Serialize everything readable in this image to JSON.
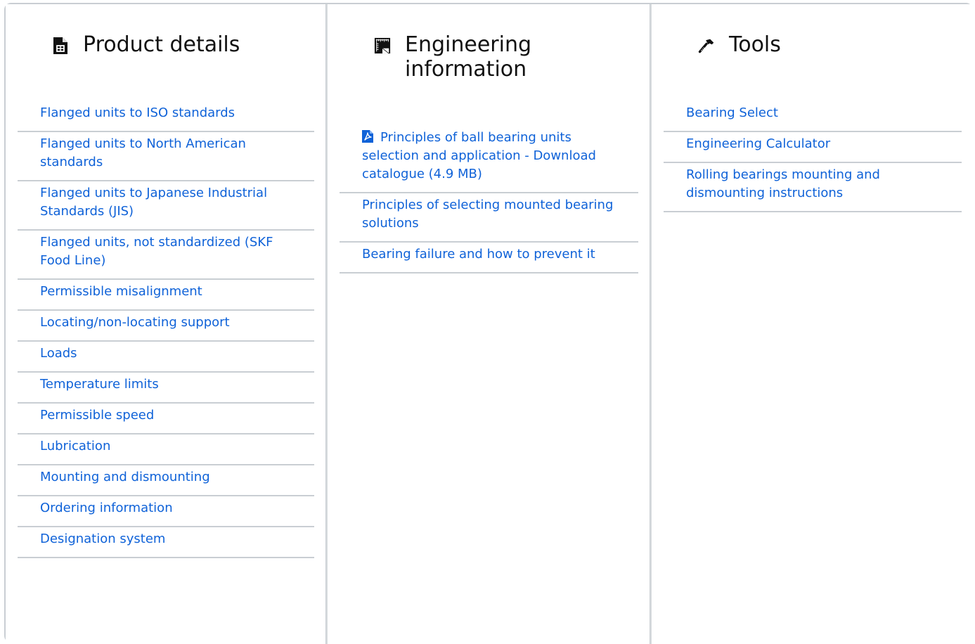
{
  "columns": {
    "product": {
      "title": "Product details",
      "icon": "product-document-icon",
      "links": [
        "Flanged units to ISO standards",
        "Flanged units to North American standards",
        "Flanged units to Japanese Industrial Standards (JIS)",
        "Flanged units, not standardized (SKF Food Line)",
        "Permissible misalignment",
        "Locating/non-locating support",
        "Loads",
        "Temperature limits",
        "Permissible speed",
        "Lubrication",
        "Mounting and dismounting",
        "Ordering information",
        "Designation system"
      ]
    },
    "engineering": {
      "title": "Engineering information",
      "icon": "engineering-book-icon",
      "links": [
        "Principles of ball bearing units selection and application - Download catalogue (4.9 MB)",
        "Principles of selecting mounted bearing solutions",
        "Bearing failure and how to prevent it"
      ],
      "first_link_icon": "pdf-icon"
    },
    "tools": {
      "title": "Tools",
      "icon": "hammer-icon",
      "links": [
        "Bearing Select",
        "Engineering Calculator",
        "Rolling bearings mounting and dismounting instructions"
      ]
    }
  },
  "colors": {
    "link": "#0f62d8",
    "divider": "#c9ced3",
    "title": "#111111"
  }
}
